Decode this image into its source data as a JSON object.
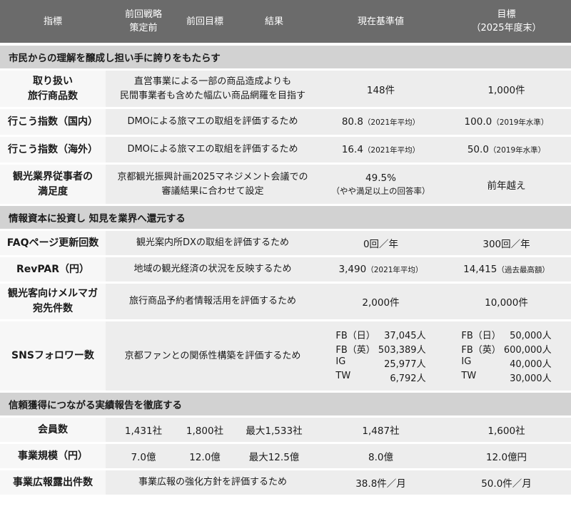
{
  "header": {
    "indicator": "指標",
    "prev_strategy_l1": "前回戦略",
    "prev_strategy_l2": "策定前",
    "prev_target": "前回目標",
    "result": "結果",
    "current": "現在基準値",
    "target_l1": "目標",
    "target_l2": "（2025年度末）"
  },
  "sections": {
    "s1": "市民からの理解を醸成し担い手に誇りをもたらす",
    "s2": "情報資本に投資し 知見を業界へ還元する",
    "s3": "信頼獲得につながる実績報告を徹底する"
  },
  "rows": {
    "r1": {
      "ind_l1": "取り扱い",
      "ind_l2": "旅行商品数",
      "note_l1": "直営事業による一部の商品造成よりも",
      "note_l2": "民間事業者も含めた幅広い商品網羅を目指す",
      "current": "148件",
      "target": "1,000件"
    },
    "r2": {
      "ind": "行こう指数（国内）",
      "note": "DMOによる旅マエの取組を評価するため",
      "current": "80.8",
      "current_sub": "（2021年平均）",
      "target": "100.0",
      "target_sub": "（2019年水準）"
    },
    "r3": {
      "ind": "行こう指数（海外）",
      "note": "DMOによる旅マエの取組を評価するため",
      "current": "16.4",
      "current_sub": "（2021年平均）",
      "target": "50.0",
      "target_sub": "（2019年水準）"
    },
    "r4": {
      "ind_l1": "観光業界従事者の",
      "ind_l2": "満足度",
      "note_l1": "京都観光振興計画2025マネジメント会議での",
      "note_l2": "審議結果に合わせて設定",
      "current": "49.5%",
      "current_sub": "（やや満足以上の回答率）",
      "target": "前年越え"
    },
    "r5": {
      "ind": "FAQページ更新回数",
      "note": "観光案内所DXの取組を評価するため",
      "current": "0回／年",
      "target": "300回／年"
    },
    "r6": {
      "ind": "RevPAR（円）",
      "note": "地域の観光経済の状況を反映するため",
      "current": "3,490",
      "current_sub": "（2021年平均）",
      "target": "14,415",
      "target_sub": "（過去最高額）"
    },
    "r7": {
      "ind_l1": "観光客向けメルマガ",
      "ind_l2": "宛先件数",
      "note": "旅行商品予約者情報活用を評価するため",
      "current": "2,000件",
      "target": "10,000件"
    },
    "r8": {
      "ind": "SNSフォロワー数",
      "note": "京都ファンとの関係性構築を評価するため",
      "current": [
        {
          "label": "FB（日）",
          "value": "37,045人"
        },
        {
          "label": "FB（英）",
          "value": "503,389人"
        },
        {
          "label": "IG",
          "value": "25,977人"
        },
        {
          "label": "TW",
          "value": "6,792人"
        }
      ],
      "target": [
        {
          "label": "FB（日）",
          "value": "50,000人"
        },
        {
          "label": "FB（英）",
          "value": "600,000人"
        },
        {
          "label": "IG",
          "value": "40,000人"
        },
        {
          "label": "TW",
          "value": "30,000人"
        }
      ]
    },
    "r9": {
      "ind": "会員数",
      "prev": "1,431社",
      "prev_target": "1,800社",
      "result": "最大1,533社",
      "current": "1,487社",
      "target": "1,600社"
    },
    "r10": {
      "ind": "事業規模（円）",
      "prev": "7.0億",
      "prev_target": "12.0億",
      "result": "最大12.5億",
      "current": "8.0億",
      "target": "12.0億円"
    },
    "r11": {
      "ind": "事業広報露出件数",
      "note": "事業広報の強化方針を評価するため",
      "current": "38.8件／月",
      "target": "50.0件／月"
    }
  }
}
